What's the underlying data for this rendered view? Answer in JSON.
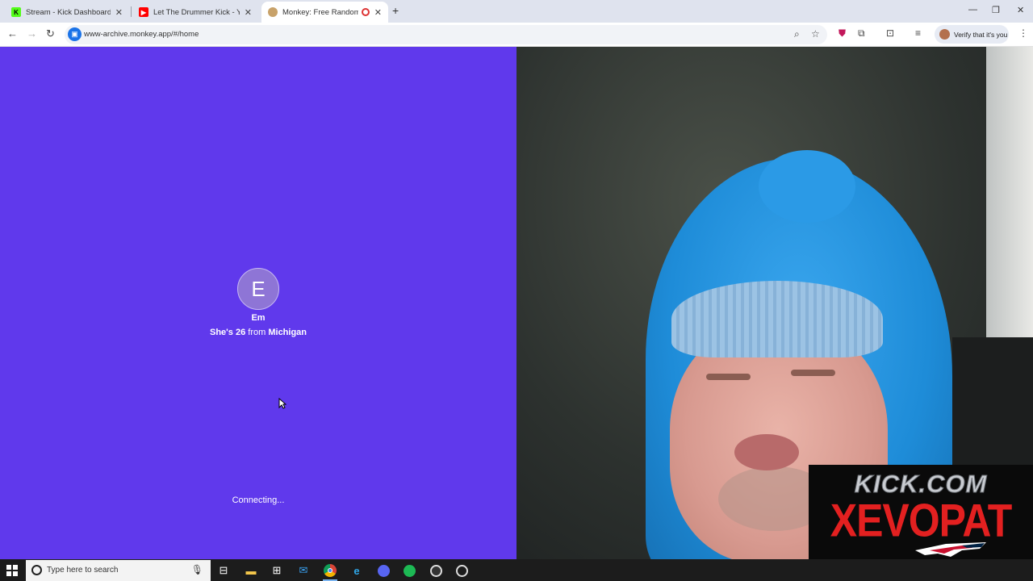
{
  "browser": {
    "tabs": [
      {
        "title": "Stream - Kick Dashboard",
        "favicon": "kick-icon",
        "favicon_color": "#53fc18",
        "active": false
      },
      {
        "title": "Let The Drummer Kick - YouTube",
        "favicon": "youtube-icon",
        "favicon_color": "#ff0000",
        "active": false
      },
      {
        "title": "Monkey: Free Random Video Chat",
        "favicon": "monkey-icon",
        "favicon_color": "#c8a26a",
        "active": true
      }
    ],
    "address": "www-archive.monkey.app/#/home",
    "verify_label": "Verify that it's you"
  },
  "match": {
    "initial": "E",
    "name": "Em",
    "pronoun": "She's",
    "age": "26",
    "from_word": "from",
    "location": "Michigan",
    "status": "Connecting..."
  },
  "stream_overlay": {
    "site": "KICK.COM",
    "channel": "XEVOPAT"
  },
  "taskbar": {
    "search_placeholder": "Type here to search",
    "apps": [
      "task-view-icon",
      "file-explorer-icon",
      "store-icon",
      "mail-icon",
      "chrome-icon",
      "edge-icon",
      "discord-icon",
      "spotify-icon",
      "obs-icon",
      "media-icon"
    ]
  },
  "colors": {
    "left_pane": "#6039ec",
    "overlay_red": "#e32020"
  }
}
